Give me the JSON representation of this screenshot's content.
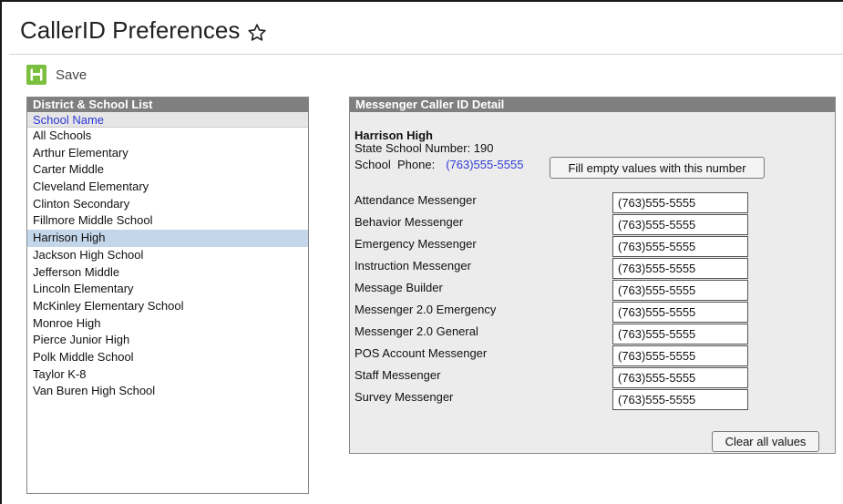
{
  "header": {
    "title": "CallerID Preferences"
  },
  "toolbar": {
    "save_label": "Save"
  },
  "school_list": {
    "panel_title": "District & School List",
    "column_header": "School Name",
    "selected": "Harrison High",
    "items": [
      "All Schools",
      "Arthur Elementary",
      "Carter Middle",
      "Cleveland Elementary",
      "Clinton Secondary",
      "Fillmore Middle School",
      "Harrison High",
      "Jackson High School",
      "Jefferson Middle",
      "Lincoln Elementary",
      "McKinley Elementary School",
      "Monroe High",
      "Pierce Junior High",
      "Polk Middle School",
      "Taylor K-8",
      "Van Buren High School"
    ]
  },
  "detail": {
    "panel_title": "Messenger Caller ID Detail",
    "school_name": "Harrison High",
    "state_number": "State School Number: 190",
    "phone_label": "School  Phone:",
    "phone_value": "(763)555-5555",
    "fill_button": "Fill empty values with this number",
    "clear_button": "Clear all values",
    "messengers": [
      {
        "label": "Attendance Messenger",
        "value": "(763)555-5555"
      },
      {
        "label": "Behavior Messenger",
        "value": "(763)555-5555"
      },
      {
        "label": "Emergency Messenger",
        "value": "(763)555-5555"
      },
      {
        "label": "Instruction Messenger",
        "value": "(763)555-5555"
      },
      {
        "label": "Message Builder",
        "value": "(763)555-5555"
      },
      {
        "label": "Messenger 2.0 Emergency",
        "value": "(763)555-5555"
      },
      {
        "label": "Messenger 2.0 General",
        "value": "(763)555-5555"
      },
      {
        "label": "POS Account Messenger",
        "value": "(763)555-5555"
      },
      {
        "label": "Staff Messenger",
        "value": "(763)555-5555"
      },
      {
        "label": "Survey Messenger",
        "value": "(763)555-5555"
      }
    ]
  },
  "colors": {
    "accent_green": "#7bbf3e",
    "header_gray": "#7f7f7f",
    "link_blue": "#2e3bd6",
    "selected_row": "#c4d6ea"
  }
}
